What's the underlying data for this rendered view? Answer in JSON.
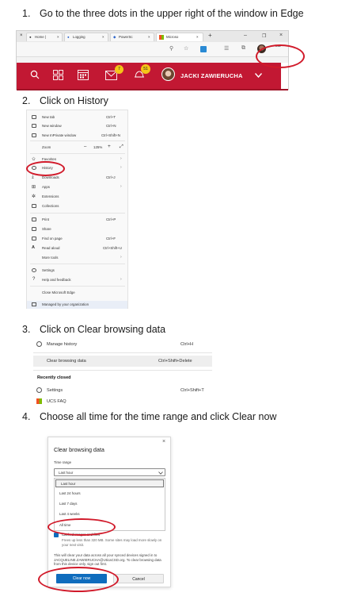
{
  "steps": [
    {
      "num": "1.",
      "text": "Go to the three dots in the upper right of the window in Edge"
    },
    {
      "num": "2.",
      "text": "Click on History"
    },
    {
      "num": "3.",
      "text": "Click on Clear browsing data"
    },
    {
      "num": "4.",
      "text": "Choose all time for the time range and click Clear now"
    }
  ],
  "browser": {
    "tabs": [
      "Home |",
      "Logging",
      "PowerSc",
      "Microso"
    ],
    "tab_close": "×",
    "new_tab": "+",
    "window_controls": [
      "–",
      "❐",
      "×"
    ],
    "more_button": "···",
    "badge_mail": "7",
    "badge_notify": "51",
    "user_name": "JACKI ZAWIERUCHA"
  },
  "menu": {
    "items": [
      {
        "label": "New tab",
        "shortcut": "Ctrl+T"
      },
      {
        "label": "New window",
        "shortcut": "Ctrl+N"
      },
      {
        "label": "New InPrivate window",
        "shortcut": "Ctrl+Shift+N"
      },
      {
        "label": "Zoom",
        "shortcut": ""
      },
      {
        "label": "Favorites",
        "shortcut": ""
      },
      {
        "label": "History",
        "shortcut": ""
      },
      {
        "label": "Downloads",
        "shortcut": "Ctrl+J"
      },
      {
        "label": "Apps",
        "shortcut": ""
      },
      {
        "label": "Extensions",
        "shortcut": ""
      },
      {
        "label": "Collections",
        "shortcut": ""
      },
      {
        "label": "Print",
        "shortcut": "Ctrl+P"
      },
      {
        "label": "Share",
        "shortcut": ""
      },
      {
        "label": "Find on page",
        "shortcut": "Ctrl+F"
      },
      {
        "label": "Read aloud",
        "shortcut": "Ctrl+Shift+U"
      },
      {
        "label": "More tools",
        "shortcut": ""
      },
      {
        "label": "Settings",
        "shortcut": ""
      },
      {
        "label": "Help and feedback",
        "shortcut": ""
      },
      {
        "label": "Close Microsoft Edge",
        "shortcut": ""
      },
      {
        "label": "Managed by your organization",
        "shortcut": ""
      }
    ],
    "zoom_value": "125%",
    "zoom_minus": "–",
    "zoom_plus": "+",
    "zoom_expand": "⤢"
  },
  "history_panel": {
    "manage_history": "Manage history",
    "manage_shortcut": "Ctrl+H",
    "clear_browsing": "Clear browsing data",
    "clear_shortcut": "Ctrl+Shift+Delete",
    "recently_closed": "Recently closed",
    "settings": "Settings",
    "settings_shortcut": "Ctrl+Shift+T",
    "ucs_faq": "UCS FAQ"
  },
  "dialog": {
    "title": "Clear browsing data",
    "close": "×",
    "time_range_label": "Time range",
    "selected": "Last hour",
    "options": [
      "Last hour",
      "Last 24 hours",
      "Last 7 days",
      "Last 4 weeks",
      "All time"
    ],
    "cached_title": "Cached images and files",
    "cached_desc": "Frees up less than 320 MB. Some sites may load more slowly on your next visit.",
    "sync_note": "This will clear your data across all your synced devices signed in to JACQUELINE.ZAWIERUCHA@UticaCSD.org. To clear browsing data from this device only, sign out first.",
    "clear_now": "Clear now",
    "cancel": "Cancel"
  }
}
